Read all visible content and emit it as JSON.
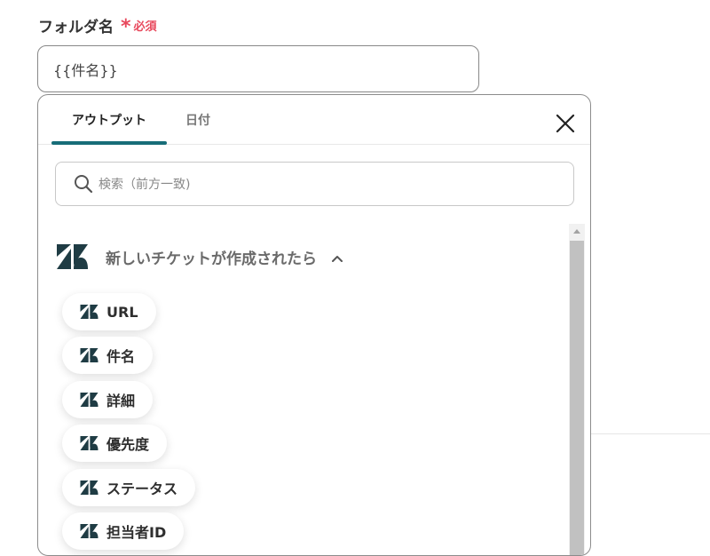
{
  "field": {
    "label": "フォルダ名",
    "required_star": "*",
    "required_text": "必須",
    "value": "{{件名}}"
  },
  "panel": {
    "tabs": [
      {
        "label": "アウトプット",
        "active": true
      },
      {
        "label": "日付",
        "active": false
      }
    ],
    "search_placeholder": "検索（前方一致)",
    "section": {
      "title": "新しいチケットが作成されたら",
      "expanded": true,
      "items": [
        {
          "label": "URL"
        },
        {
          "label": "件名"
        },
        {
          "label": "詳細"
        },
        {
          "label": "優先度"
        },
        {
          "label": "ステータス"
        },
        {
          "label": "担当者ID"
        }
      ]
    }
  },
  "icons": {
    "close": "close-icon",
    "search": "search-icon",
    "app_logo": "zendesk-logo-icon",
    "collapse": "chevron-up-icon"
  },
  "colors": {
    "accent": "#176d78",
    "required": "#e8495d",
    "logo": "#1f3c44"
  }
}
